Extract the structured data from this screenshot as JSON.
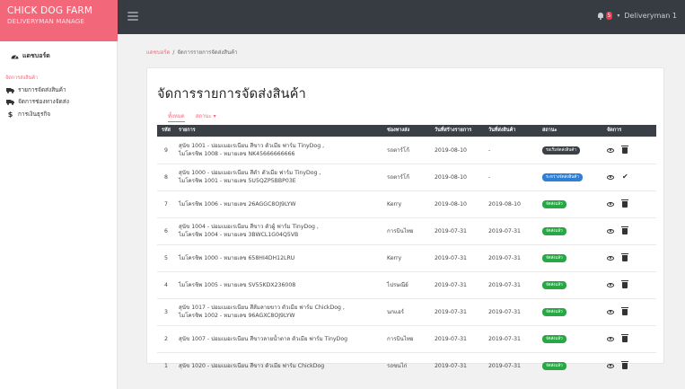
{
  "app": {
    "brand_line1": "CHICK DOG FARM",
    "brand_line2": "DELIVERYMAN MANAGE"
  },
  "topbar": {
    "notification_count": "5",
    "user_label": "Deliveryman 1"
  },
  "sidebar": {
    "dashboard_label": "แดชบอร์ด",
    "section_label": "จัดการส่งสินค้า",
    "items": [
      {
        "label": "รายการจัดส่งสินค้า",
        "icon": "truck-icon"
      },
      {
        "label": "จัดการช่องทางจัดส่ง",
        "icon": "truck-icon"
      },
      {
        "label": "การเงินธุรกิจ",
        "icon": "dollar-icon"
      }
    ]
  },
  "breadcrumb": {
    "home": "แดชบอร์ด",
    "separator": "/",
    "current": "จัดการรายการจัดส่งสินค้า"
  },
  "page": {
    "title": "จัดการรายการจัดส่งสินค้า"
  },
  "filters": {
    "all": "ทั้งหมด",
    "status": "สถานะ ▾"
  },
  "table": {
    "headers": [
      "รหัส",
      "รายการ",
      "ช่องทางส่ง",
      "วันที่สร้างรายการ",
      "วันที่ส่งสินค้า",
      "สถานะ",
      "จัดการ"
    ],
    "rows": [
      {
        "id": "9",
        "line1": "สุนัข 1001 - ปอมเมอเรเนียน สีขาว ตัวเมีย ฟาร์ม TinyDog ,",
        "line2": "ไมโครชิพ 1008 - หมายเลข NK45666666666",
        "carrier": "รถตาร์โก้",
        "created": "2019-08-10",
        "shipped": "-",
        "status": "รอเริ่มจัดส่งสินค้า",
        "status_color": "#3a4046",
        "action2": "trash"
      },
      {
        "id": "8",
        "line1": "สุนัข 1000 - ปอมเมอเรเนียน สีดำ ตัวเมีย ฟาร์ม TinyDog ,",
        "line2": "ไมโครชิพ 1001 - หมายเลข 5U5QZP5BBP03E",
        "carrier": "รถตาร์โก้",
        "created": "2019-08-10",
        "shipped": "-",
        "status": "ระหว่างจัดส่งสินค้า",
        "status_color": "#2f7fd4",
        "action2": "check"
      },
      {
        "id": "7",
        "line1": "ไมโครชิพ 1006 - หมายเลข 26AGGC8OJ9LYW",
        "line2": "",
        "carrier": "Kerry",
        "created": "2019-08-10",
        "shipped": "2019-08-10",
        "status": "จัดส่งแล้ว",
        "status_color": "#28a745",
        "action2": "trash"
      },
      {
        "id": "6",
        "line1": "สุนัข 1004 - ปอมเมอเรเนียน สีขาว ตัวผู้ ฟาร์ม TinyDog ,",
        "line2": "ไมโครชิพ 1004 - หมายเลข 3BWCL1G04Q5VB",
        "carrier": "การบินไทย",
        "created": "2019-07-31",
        "shipped": "2019-07-31",
        "status": "จัดส่งแล้ว",
        "status_color": "#28a745",
        "action2": "trash"
      },
      {
        "id": "5",
        "line1": "ไมโครชิพ 1000 - หมายเลข 658HI4DH12LRU",
        "line2": "",
        "carrier": "Kerry",
        "created": "2019-07-31",
        "shipped": "2019-07-31",
        "status": "จัดส่งแล้ว",
        "status_color": "#28a745",
        "action2": "trash"
      },
      {
        "id": "4",
        "line1": "ไมโครชิพ 1005 - หมายเลข SV55KDX236008",
        "line2": "",
        "carrier": "ไปรษณีย์",
        "created": "2019-07-31",
        "shipped": "2019-07-31",
        "status": "จัดส่งแล้ว",
        "status_color": "#28a745",
        "action2": "trash"
      },
      {
        "id": "3",
        "line1": "สุนัข 1017 - ปอมเมอเรเนียน สีส้มลายขาว ตัวเมีย ฟาร์ม ChickDog ,",
        "line2": "ไมโครชิพ 1002 - หมายเลข 96AGXC8OJ9LYW",
        "carrier": "นกแอร์",
        "created": "2019-07-31",
        "shipped": "2019-07-31",
        "status": "จัดส่งแล้ว",
        "status_color": "#28a745",
        "action2": "trash"
      },
      {
        "id": "2",
        "line1": "สุนัข 1007 - ปอมเมอเรเนียน สีขาวลายน้ำตาล ตัวเมีย ฟาร์ม TinyDog",
        "line2": "",
        "carrier": "การบินไทย",
        "created": "2019-07-31",
        "shipped": "2019-07-31",
        "status": "จัดส่งแล้ว",
        "status_color": "#28a745",
        "action2": "trash"
      },
      {
        "id": "1",
        "line1": "สุนัข 1020 - ปอมเมอเรเนียน สีขาว ตัวเมีย ฟาร์ม ChickDog",
        "line2": "",
        "carrier": "รถขนไก่",
        "created": "2019-07-31",
        "shipped": "2019-07-31",
        "status": "จัดส่งแล้ว",
        "status_color": "#28a745",
        "action2": "trash"
      }
    ]
  }
}
